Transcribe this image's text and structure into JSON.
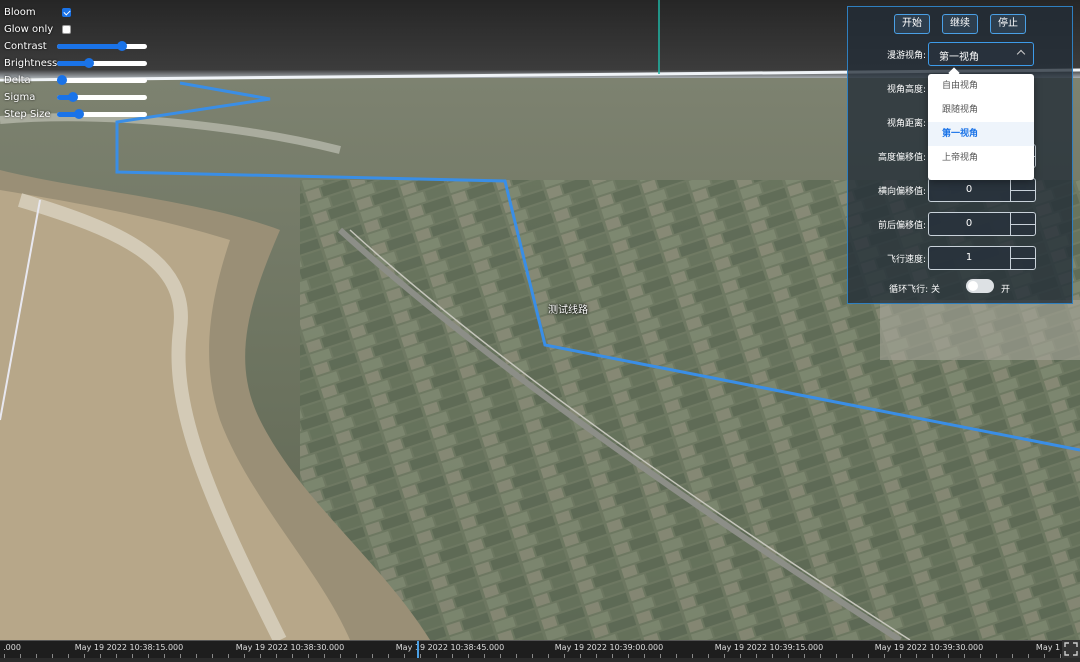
{
  "bloom_panel": {
    "bloom": {
      "label": "Bloom",
      "checked": true
    },
    "glow_only": {
      "label": "Glow only",
      "checked": false
    },
    "sliders": [
      {
        "key": "contrast",
        "label": "Contrast",
        "value": 0.72
      },
      {
        "key": "brightness",
        "label": "Brightness",
        "value": 0.36
      },
      {
        "key": "delta",
        "label": "Delta",
        "value": 0.06
      },
      {
        "key": "sigma",
        "label": "Sigma",
        "value": 0.18
      },
      {
        "key": "step_size",
        "label": "Step Size",
        "value": 0.24
      }
    ]
  },
  "roam_panel": {
    "buttons": {
      "start": "开始",
      "continue": "继续",
      "stop": "停止"
    },
    "view_mode": {
      "label": "漫游视角:",
      "selected": "第一视角",
      "options": [
        "自由视角",
        "跟随视角",
        "第一视角",
        "上帝视角"
      ]
    },
    "view_height": {
      "label": "视角高度:"
    },
    "view_distance": {
      "label": "视角距离:"
    },
    "height_offset": {
      "label": "高度偏移值:"
    },
    "lateral_offset": {
      "label": "横向偏移值:",
      "value": "0"
    },
    "longitudinal_offset": {
      "label": "前后偏移值:",
      "value": "0"
    },
    "flight_speed": {
      "label": "飞行速度:",
      "value": "1"
    },
    "loop_flight": {
      "label": "循环飞行: 关",
      "on_label": "开",
      "enabled": false
    }
  },
  "route_label": "测试线路",
  "timeline": {
    "labels": [
      ".000",
      "May 19 2022 10:38:15.000",
      "May 19 2022 10:38:30.000",
      "May 19 2022 10:38:45.000",
      "May 19 2022 10:39:00.000",
      "May 19 2022 10:39:15.000",
      "May 19 2022 10:39:30.000",
      "May 1"
    ]
  },
  "colors": {
    "accent": "#1a73e8",
    "route": "#3a8ee6",
    "panel_border": "#2f7fbf"
  },
  "icons": {
    "fullscreen": "fullscreen-icon"
  }
}
